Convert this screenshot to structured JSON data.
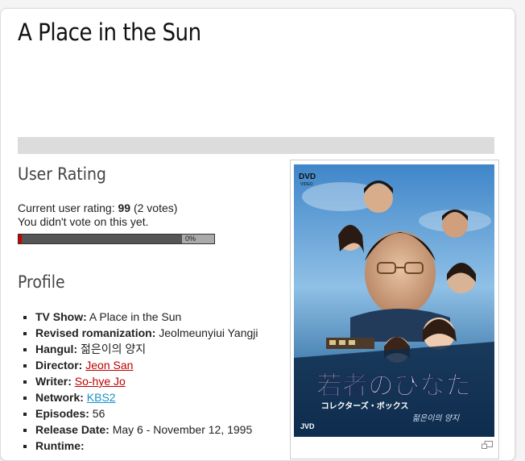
{
  "page": {
    "title": "A Place in the Sun"
  },
  "user_rating": {
    "heading": "User Rating",
    "current_label": "Current user rating:",
    "score": "99",
    "votes": "(2 votes)",
    "not_voted": "You didn't vote on this yet.",
    "percent_label": "0%",
    "score_value": 99
  },
  "profile": {
    "heading": "Profile",
    "items": [
      {
        "label": "TV Show:",
        "value": "A Place in the Sun"
      },
      {
        "label": "Revised romanization:",
        "value": "Jeolmeunyiui Yangji"
      },
      {
        "label": "Hangul:",
        "value": "젊은이의 양지"
      },
      {
        "label": "Director:",
        "value": "Jeon San"
      },
      {
        "label": "Writer:",
        "value": "So-hye Jo"
      },
      {
        "label": "Network:",
        "value": "KBS2"
      },
      {
        "label": "Episodes:",
        "value": "56"
      },
      {
        "label": "Release Date:",
        "value": "May 6 - November 12, 1995"
      },
      {
        "label": "Runtime:",
        "value": ""
      }
    ]
  },
  "poster": {
    "title_jp": "若者のひなた",
    "subtitle_jp": "コレクターズ・ボックス",
    "subtitle_kr": "젊은이의 양지",
    "dvd_logo": "DVD",
    "dvd_video": "VIDEO",
    "publisher_logo": "JVD",
    "icon": "enlarge-icon",
    "colors": {
      "sky": "#6aa6d8",
      "title": "#ffffff"
    }
  }
}
